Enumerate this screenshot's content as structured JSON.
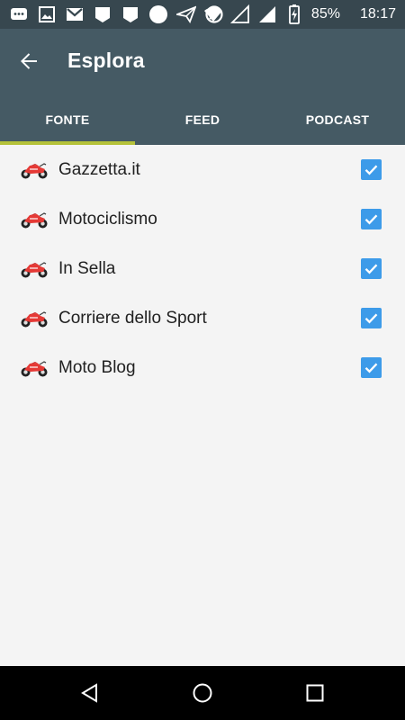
{
  "status_bar": {
    "battery": "85%",
    "time": "18:17"
  },
  "app_bar": {
    "title": "Esplora",
    "back_icon": "arrow-back-icon"
  },
  "tabs": [
    {
      "label": "FONTE",
      "active": true
    },
    {
      "label": "FEED",
      "active": false
    },
    {
      "label": "PODCAST",
      "active": false
    }
  ],
  "sources": [
    {
      "label": "Gazzetta.it",
      "checked": true,
      "icon": "motorcycle-icon"
    },
    {
      "label": "Motociclismo",
      "checked": true,
      "icon": "motorcycle-icon"
    },
    {
      "label": "In Sella",
      "checked": true,
      "icon": "motorcycle-icon"
    },
    {
      "label": "Corriere dello Sport",
      "checked": true,
      "icon": "motorcycle-icon"
    },
    {
      "label": "Moto Blog",
      "checked": true,
      "icon": "motorcycle-icon"
    }
  ],
  "colors": {
    "app_bar": "#455a64",
    "status_bar": "#37474f",
    "tab_indicator": "#b5c23a",
    "checkbox": "#3d9be9"
  }
}
